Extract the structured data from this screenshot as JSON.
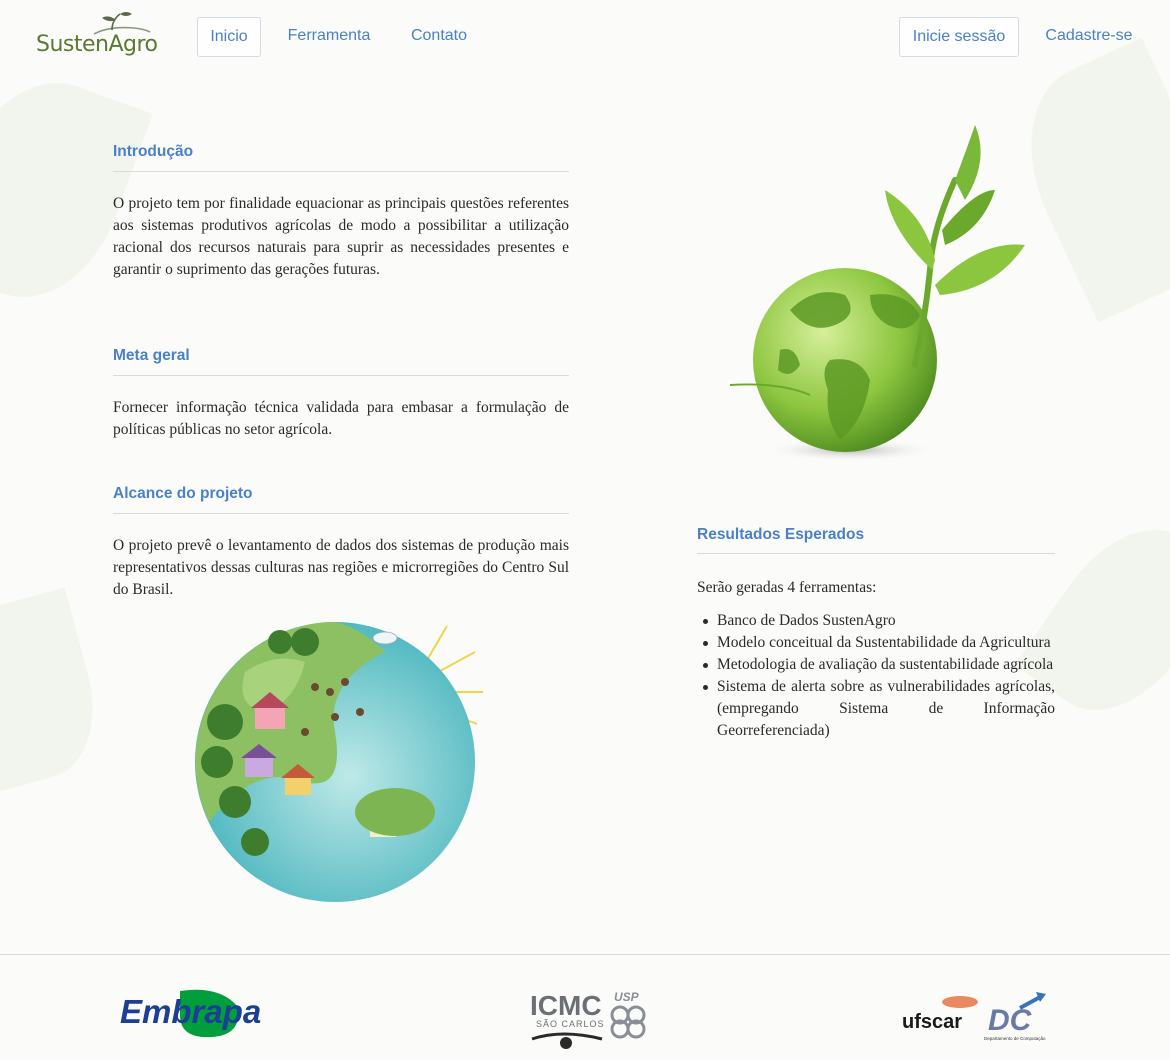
{
  "nav": {
    "brand": "SustenAgro",
    "links": [
      {
        "label": "Inicio"
      },
      {
        "label": "Ferramenta"
      },
      {
        "label": "Contato"
      }
    ],
    "login_label": "Inicie sessão",
    "signup_label": "Cadastre-se"
  },
  "intro": {
    "title": "Introdução",
    "text": "O projeto tem por finalidade equacionar as principais questões referentes aos sistemas produtivos agrícolas de modo a possibilitar a utilização racional dos recursos naturais para suprir as necessidades presentes e garantir o suprimento das gerações futuras."
  },
  "goal": {
    "title": "Meta geral",
    "text": "Fornecer informação técnica validada para embasar a formulação de políticas públicas no setor agrícola."
  },
  "scope": {
    "title": "Alcance do projeto",
    "text": "O projeto prevê o levantamento de dados dos sistemas de produção mais representativos dessas culturas nas regiões e microrregiões do Centro Sul do Brasil."
  },
  "results": {
    "title": "Resultados Esperados",
    "intro": "Serão geradas 4 ferramentas:",
    "items": [
      "Banco de Dados SustenAgro",
      "Modelo conceitual da Sustentabilidade da Agricultura",
      "Metodologia de avaliação da sustentabilidade agrícola",
      "Sistema de alerta sobre as vulnerabilidades agrícolas, (empregando Sistema de Informação Georreferenciada)"
    ]
  },
  "footer": {
    "embrapa": "Embrapa",
    "icmc_main": "ICMC",
    "icmc_sub": "SÃO CARLOS",
    "icmc_usp": "USP",
    "ufscar": "ufscar",
    "dc": "DC",
    "dc_sub": "Departamento de Computação"
  },
  "colors": {
    "link": "#4a80c8",
    "brand_green": "#5a7a33",
    "embrapa_blue": "#1c3f94",
    "embrapa_green": "#009e3d"
  }
}
